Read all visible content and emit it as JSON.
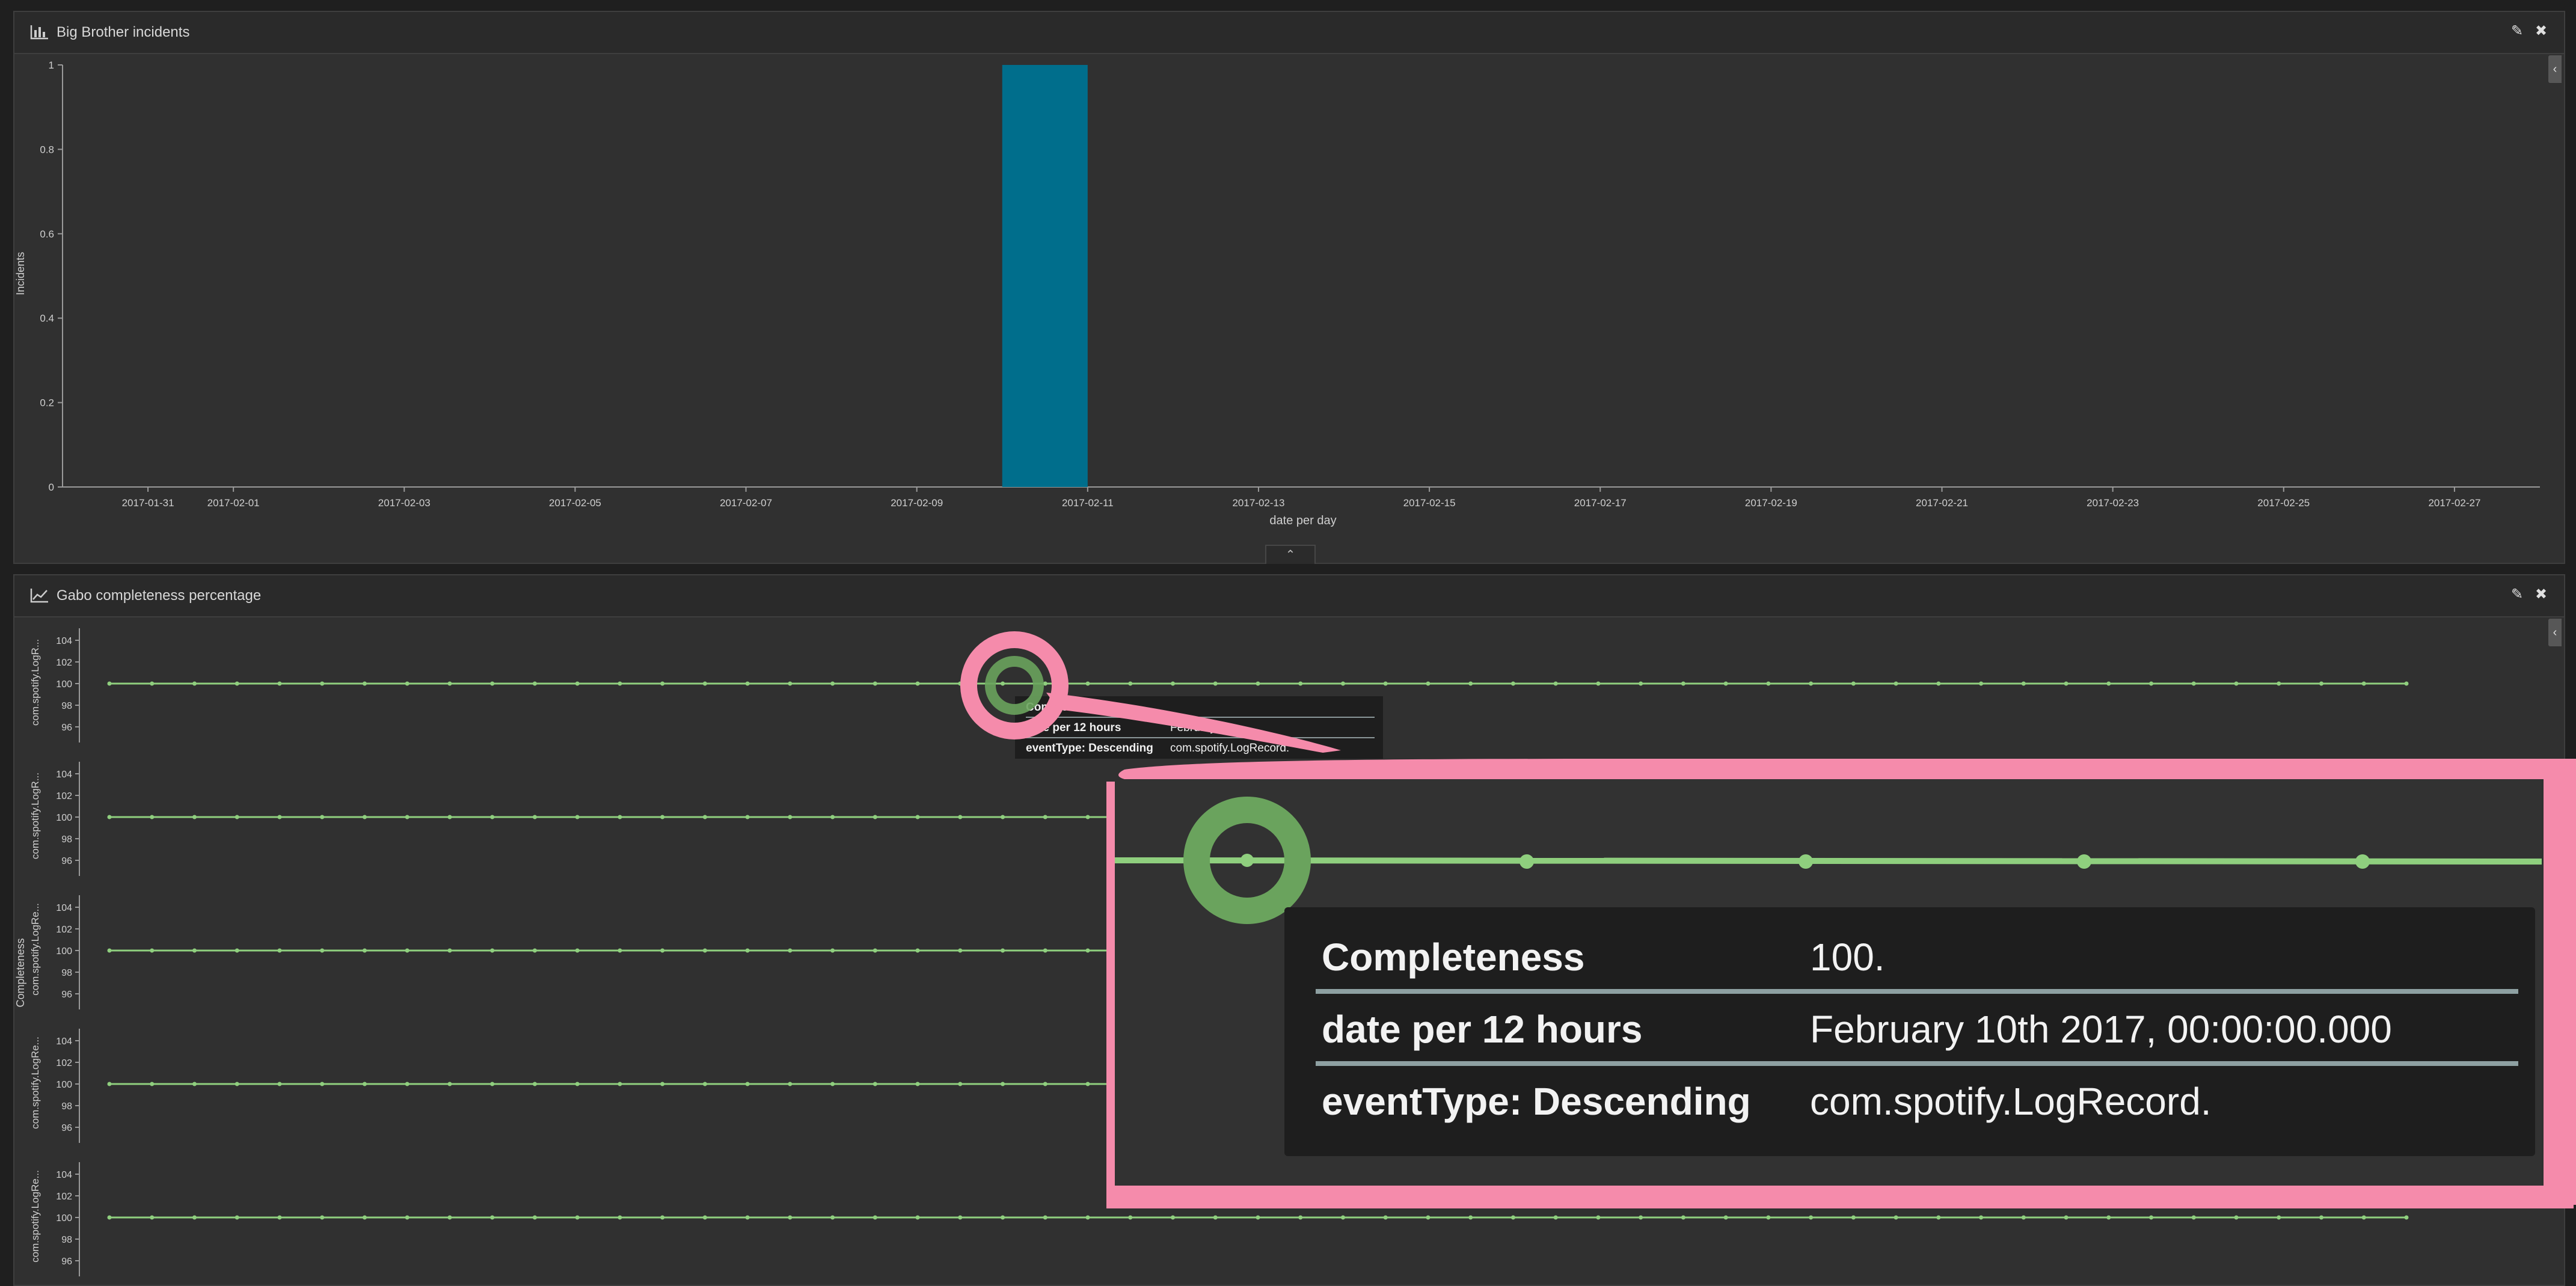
{
  "panels": [
    {
      "title": "Big Brother incidents",
      "icon": "bar-chart-icon"
    },
    {
      "title": "Gabo completeness percentage",
      "icon": "line-chart-icon"
    }
  ],
  "chart_data": [
    {
      "type": "bar",
      "title": "Big Brother incidents",
      "xlabel": "date per day",
      "ylabel": "Incidents",
      "ylim": [
        0,
        1
      ],
      "yticks": [
        0,
        0.2,
        0.4,
        0.6,
        0.8,
        1
      ],
      "xticks": [
        "2017-01-31",
        "2017-02-01",
        "2017-02-03",
        "2017-02-05",
        "2017-02-07",
        "2017-02-09",
        "2017-02-11",
        "2017-02-13",
        "2017-02-15",
        "2017-02-17",
        "2017-02-19",
        "2017-02-21",
        "2017-02-23",
        "2017-02-25",
        "2017-02-27"
      ],
      "x_range": [
        "2017-01-30",
        "2017-02-28"
      ],
      "bar_color": "#006e8c",
      "bars": [
        {
          "x": "2017-02-10",
          "value": 1
        }
      ]
    },
    {
      "type": "line",
      "title": "Gabo completeness percentage",
      "ylabel": "Completeness",
      "ylim": [
        95,
        105
      ],
      "yticks": [
        96,
        98,
        100,
        102,
        104
      ],
      "line_color": "#8fcf7e",
      "x_interval": "12 hours",
      "x_range": [
        "2017-01-31 00:00",
        "2017-02-27 00:00"
      ],
      "series": [
        {
          "name": "com.spotify.LogR...",
          "value": 100
        },
        {
          "name": "com.spotify.LogR...",
          "value": 100
        },
        {
          "name": "com.spotify.LogRe...",
          "value": 100
        },
        {
          "name": "com.spotify.LogRe...",
          "value": 100
        },
        {
          "name": "com.spotify.LogRe...",
          "value": 100
        }
      ]
    }
  ],
  "tooltip": {
    "rows": [
      {
        "key": "Completeness",
        "value": "100."
      },
      {
        "key": "date per 12 hours",
        "value": "February 10th 2017, 00:00:00.000"
      },
      {
        "key": "eventType: Descending",
        "value": "com.spotify.LogRecord."
      }
    ],
    "small_rows": [
      {
        "key": "Completeness",
        "value": ""
      },
      {
        "key": "date per 12 hours",
        "value": "February 1..."
      },
      {
        "key": "eventType: Descending",
        "value": "com.spotify.LogRecord."
      }
    ]
  },
  "colors": {
    "annotation": "#f58bab",
    "highlight_ring": "#6aa35d"
  }
}
